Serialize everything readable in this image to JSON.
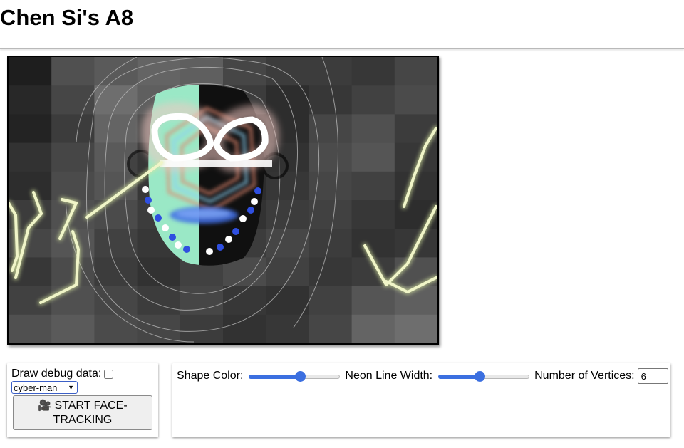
{
  "page": {
    "title": "Chen Si's A8"
  },
  "controls": {
    "debug_label": "Draw debug data:",
    "debug_checked": false,
    "mode_select": {
      "value": "cyber-man"
    },
    "start_button": {
      "icon": "video-camera-icon",
      "label": "START FACE-TRACKING"
    }
  },
  "settings": {
    "shape_color": {
      "label": "Shape Color:",
      "value": 0.56
    },
    "neon_line_width": {
      "label": "Neon Line Width:",
      "value": 0.45
    },
    "vertices": {
      "label": "Number of Vertices:",
      "value": "6"
    }
  },
  "colors": {
    "accent": "#3b6fe0",
    "mask_mint": "#9ae8c6",
    "neon": "#f0f5c8",
    "dots_blue": "#2f4fe0"
  }
}
